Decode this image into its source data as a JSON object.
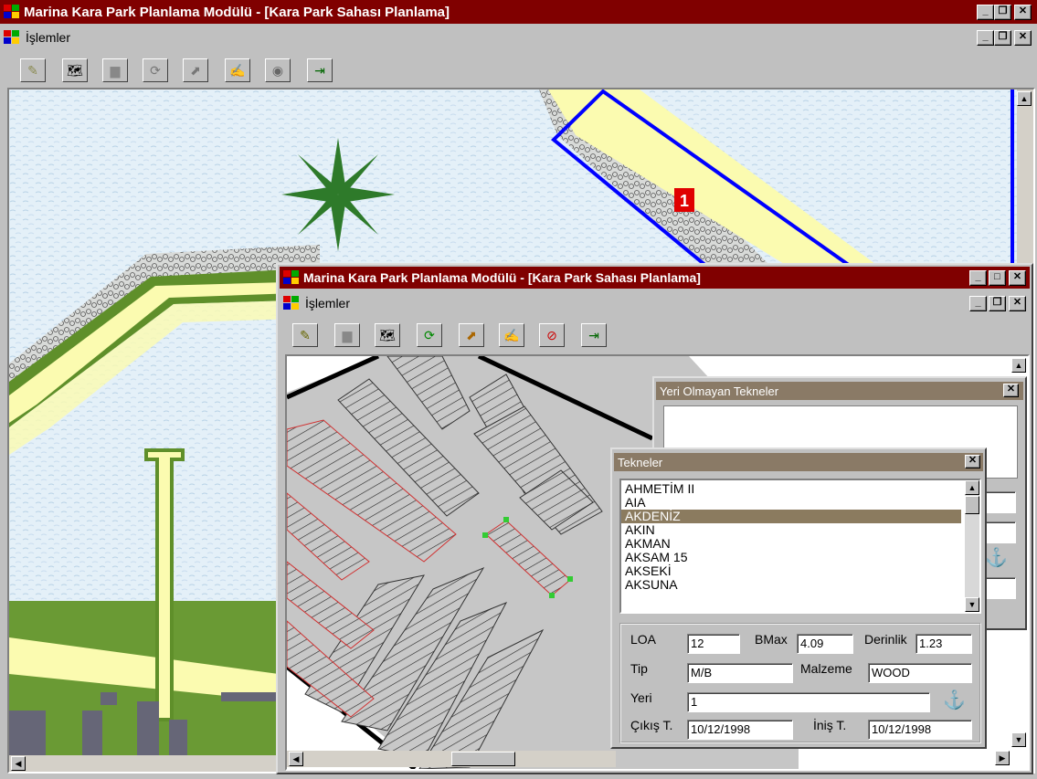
{
  "main_window": {
    "title": "Marina Kara Park Planlama Modülü - [Kara Park Sahası Planlama]",
    "menu": "İşlemler",
    "map_label": "1"
  },
  "child_window": {
    "title": "Marina Kara Park Planlama Modülü - [Kara Park Sahası Planlama]",
    "menu": "İşlemler"
  },
  "yeri_olmayan_panel": {
    "title": "Yeri Olmayan Tekneler"
  },
  "tekneler_panel": {
    "title": "Tekneler",
    "items": [
      "AHMETİM II",
      "AIA",
      "AKDENİZ",
      "AKIN",
      "AKMAN",
      "AKSAM 15",
      "AKSEKİ",
      "AKSUNA"
    ],
    "selected_index": 2,
    "fields": {
      "loa_label": "LOA",
      "loa_value": "12",
      "bmax_label": "BMax",
      "bmax_value": "4.09",
      "derinlik_label": "Derinlik",
      "derinlik_value": "1.23",
      "tip_label": "Tip",
      "tip_value": "M/B",
      "malzeme_label": "Malzeme",
      "malzeme_value": "WOOD",
      "yeri_label": "Yeri",
      "yeri_value": "1",
      "cikis_label": "Çıkış T.",
      "cikis_value": "10/12/1998",
      "inis_label": "İniş T.",
      "inis_value": "10/12/1998"
    }
  },
  "icons": {
    "window_controls": [
      "minimize-icon",
      "restore-icon",
      "close-icon"
    ],
    "toolbar": [
      "save-edit-icon",
      "map-icon",
      "truck-icon",
      "refresh-icon",
      "chart-icon",
      "paint-icon",
      "globe-icon",
      "exit-icon"
    ]
  },
  "colors": {
    "title_bar": "#800000",
    "selection": "#8b7b5f",
    "panel_title": "#8a7a66",
    "boat_outline": "#0000ff"
  }
}
